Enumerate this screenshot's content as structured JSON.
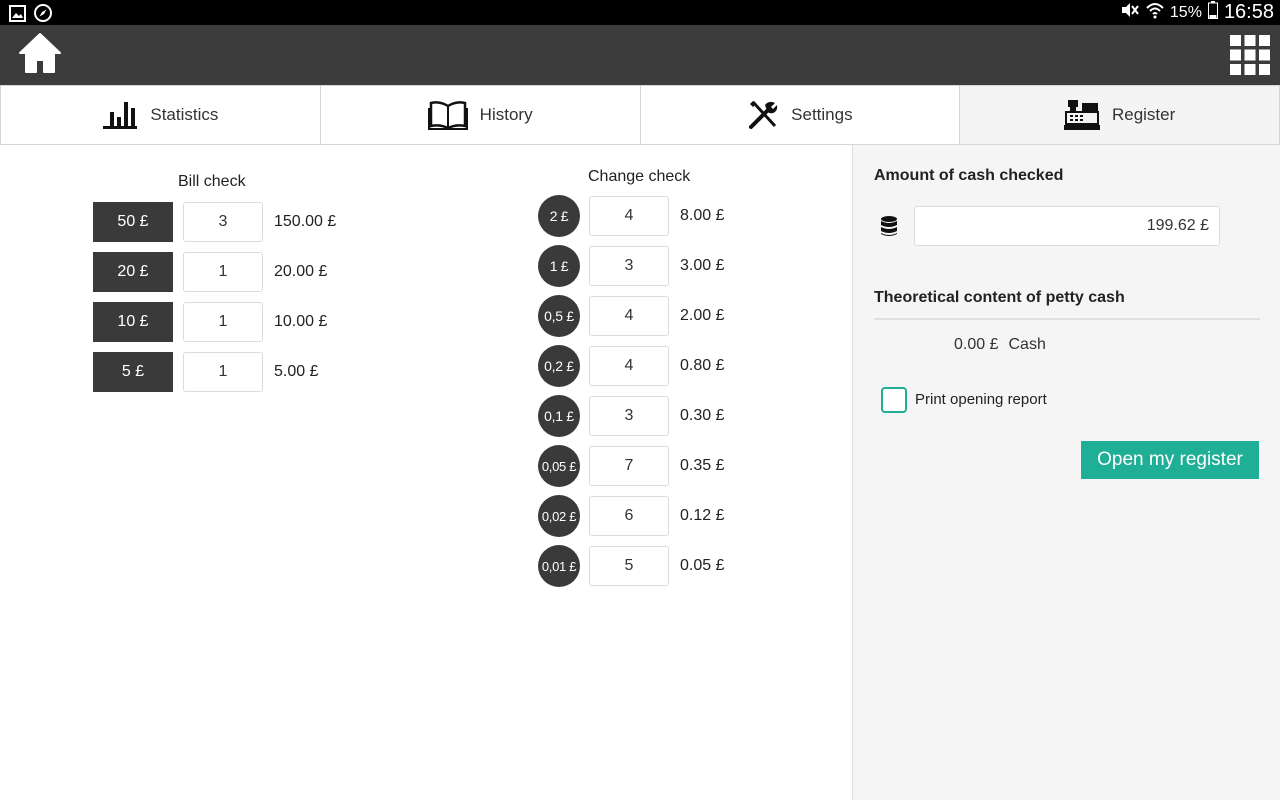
{
  "status_bar": {
    "battery": "15%",
    "time": "16:58"
  },
  "tabs": [
    {
      "label": "Statistics",
      "icon": "bar-chart-icon"
    },
    {
      "label": "History",
      "icon": "open-book-icon"
    },
    {
      "label": "Settings",
      "icon": "tools-icon"
    },
    {
      "label": "Register",
      "icon": "cash-register-icon",
      "active": true
    }
  ],
  "bill_check": {
    "title": "Bill check",
    "rows": [
      {
        "denomination": "50 £",
        "quantity": "3",
        "total": "150.00 £"
      },
      {
        "denomination": "20 £",
        "quantity": "1",
        "total": "20.00 £"
      },
      {
        "denomination": "10 £",
        "quantity": "1",
        "total": "10.00 £"
      },
      {
        "denomination": "5 £",
        "quantity": "1",
        "total": "5.00 £"
      }
    ]
  },
  "change_check": {
    "title": "Change check",
    "rows": [
      {
        "denomination": "2 £",
        "quantity": "4",
        "total": "8.00 £"
      },
      {
        "denomination": "1 £",
        "quantity": "3",
        "total": "3.00 £"
      },
      {
        "denomination": "0,5 £",
        "quantity": "4",
        "total": "2.00 £"
      },
      {
        "denomination": "0,2 £",
        "quantity": "4",
        "total": "0.80 £"
      },
      {
        "denomination": "0,1 £",
        "quantity": "3",
        "total": "0.30 £"
      },
      {
        "denomination": "0,05 £",
        "quantity": "7",
        "total": "0.35 £"
      },
      {
        "denomination": "0,02 £",
        "quantity": "6",
        "total": "0.12 £"
      },
      {
        "denomination": "0,01 £",
        "quantity": "5",
        "total": "0.05 £"
      }
    ]
  },
  "summary": {
    "amount_heading": "Amount of cash checked",
    "amount_value": "199.62 £",
    "theoretical_heading": "Theoretical content of petty cash",
    "theoretical_amount": "0.00 £",
    "theoretical_type": "Cash",
    "print_report_label": "Print opening report",
    "print_report_checked": false,
    "open_button_label": "Open my register"
  },
  "colors": {
    "accent": "#1fae96",
    "action_bar": "#3c3c3c",
    "chip": "#3a3a3a"
  }
}
